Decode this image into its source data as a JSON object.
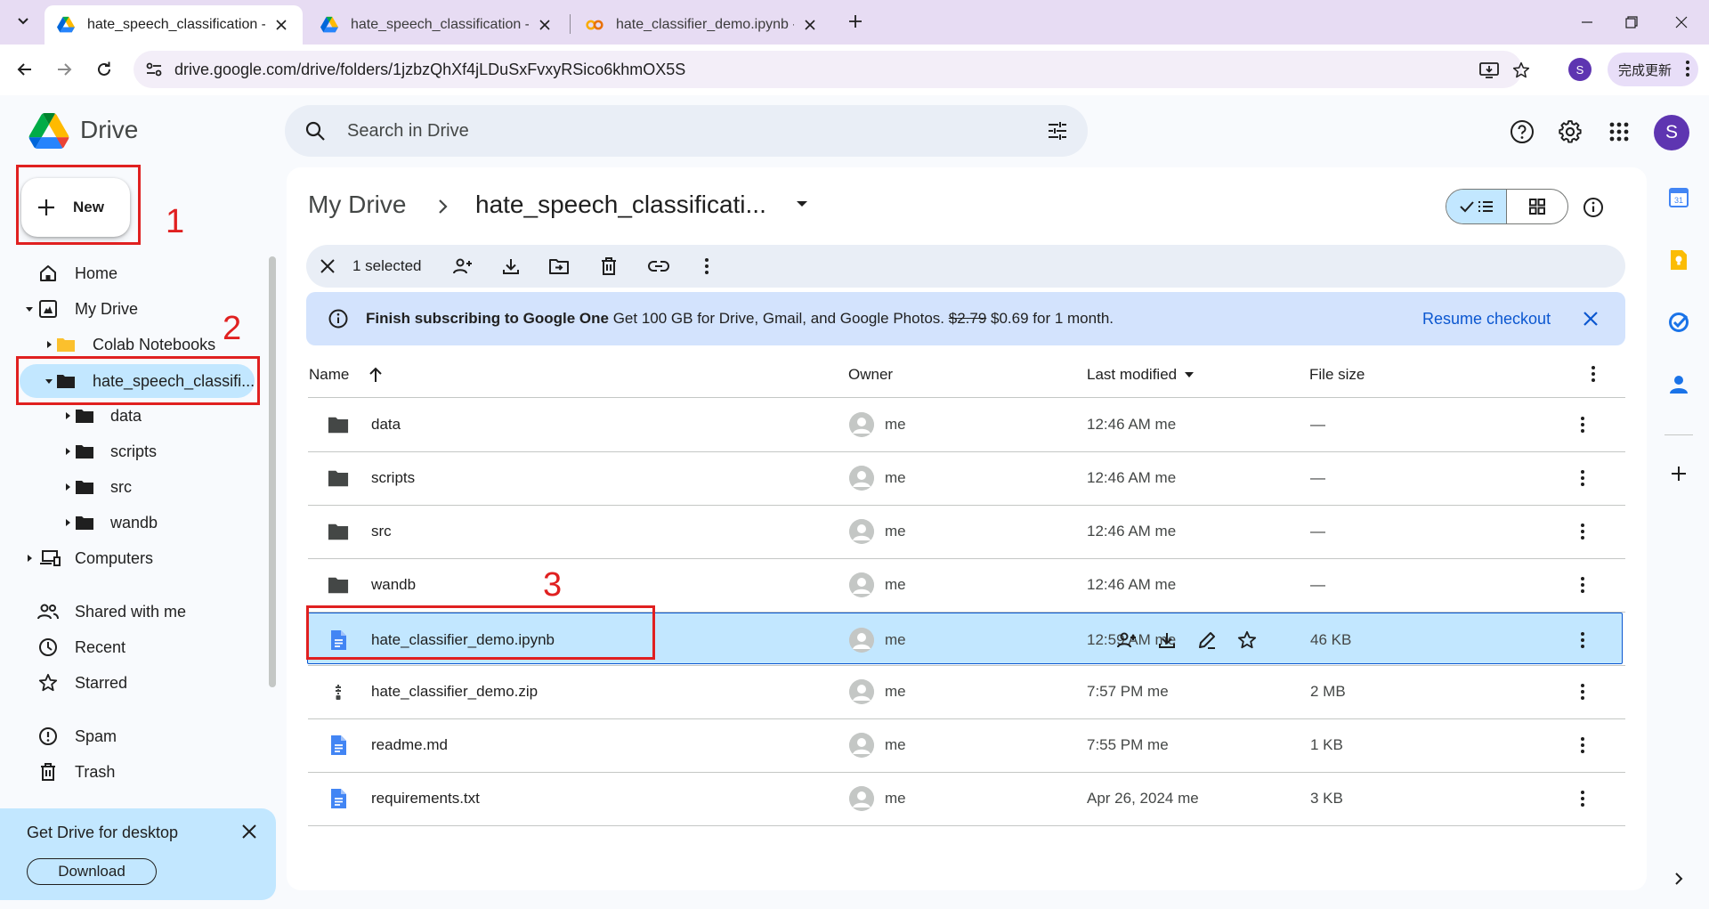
{
  "browser": {
    "tabs": [
      {
        "title": "hate_speech_classification - Go",
        "favicon": "google-drive-icon",
        "active": true
      },
      {
        "title": "hate_speech_classification - Go",
        "favicon": "google-drive-icon",
        "active": false
      },
      {
        "title": "hate_classifier_demo.ipynb - Co",
        "favicon": "colab-icon",
        "active": false
      }
    ],
    "url": "drive.google.com/drive/folders/1jzbzQhXf4jLDuSxFvxyRSico6khmOX5S",
    "profile_initial": "S",
    "update_label": "完成更新"
  },
  "drive": {
    "app_name": "Drive",
    "search_placeholder": "Search in Drive",
    "account_initial": "S"
  },
  "sidebar": {
    "new_label": "New",
    "items": [
      {
        "label": "Home",
        "icon": "home-icon"
      },
      {
        "label": "My Drive",
        "icon": "my-drive-icon"
      },
      {
        "label": "Colab Notebooks",
        "icon": "folder-icon"
      },
      {
        "label": "hate_speech_classifi...",
        "icon": "folder-icon"
      },
      {
        "label": "data",
        "icon": "folder-icon"
      },
      {
        "label": "scripts",
        "icon": "folder-icon"
      },
      {
        "label": "src",
        "icon": "folder-icon"
      },
      {
        "label": "wandb",
        "icon": "folder-icon"
      },
      {
        "label": "Computers",
        "icon": "computers-icon"
      },
      {
        "label": "Shared with me",
        "icon": "people-icon"
      },
      {
        "label": "Recent",
        "icon": "clock-icon"
      },
      {
        "label": "Starred",
        "icon": "star-icon"
      },
      {
        "label": "Spam",
        "icon": "spam-icon"
      },
      {
        "label": "Trash",
        "icon": "trash-icon"
      }
    ],
    "promo": {
      "title": "Get Drive for desktop",
      "button": "Download"
    }
  },
  "annotations": [
    "1",
    "2",
    "3"
  ],
  "main": {
    "breadcrumb_root": "My Drive",
    "breadcrumb_current": "hate_speech_classificati...",
    "selection": {
      "count_label": "1 selected"
    },
    "banner": {
      "title": "Finish subscribing to Google One",
      "text": "Get 100 GB for Drive, Gmail, and Google Photos.",
      "old_price": "$2.79",
      "offer": "$0.69 for 1 month.",
      "action": "Resume checkout"
    },
    "columns": {
      "name": "Name",
      "owner": "Owner",
      "modified": "Last modified",
      "size": "File size"
    },
    "files": [
      {
        "name": "data",
        "type": "folder",
        "owner": "me",
        "modified": "12:46 AM me",
        "size": "—"
      },
      {
        "name": "scripts",
        "type": "folder",
        "owner": "me",
        "modified": "12:46 AM me",
        "size": "—"
      },
      {
        "name": "src",
        "type": "folder",
        "owner": "me",
        "modified": "12:46 AM me",
        "size": "—"
      },
      {
        "name": "wandb",
        "type": "folder",
        "owner": "me",
        "modified": "12:46 AM me",
        "size": "—"
      },
      {
        "name": "hate_classifier_demo.ipynb",
        "type": "doc",
        "owner": "me",
        "modified": "12:59 AM me",
        "size": "46 KB",
        "selected": true
      },
      {
        "name": "hate_classifier_demo.zip",
        "type": "zip",
        "owner": "me",
        "modified": "7:57 PM me",
        "size": "2 MB"
      },
      {
        "name": "readme.md",
        "type": "doc",
        "owner": "me",
        "modified": "7:55 PM me",
        "size": "1 KB"
      },
      {
        "name": "requirements.txt",
        "type": "doc",
        "owner": "me",
        "modified": "Apr 26, 2024 me",
        "size": "3 KB"
      }
    ]
  },
  "colors": {
    "accent": "#0b57d0",
    "selected_bg": "#c2e7ff",
    "annotation": "#e02020",
    "tabstrip": "#e7dcf3"
  }
}
